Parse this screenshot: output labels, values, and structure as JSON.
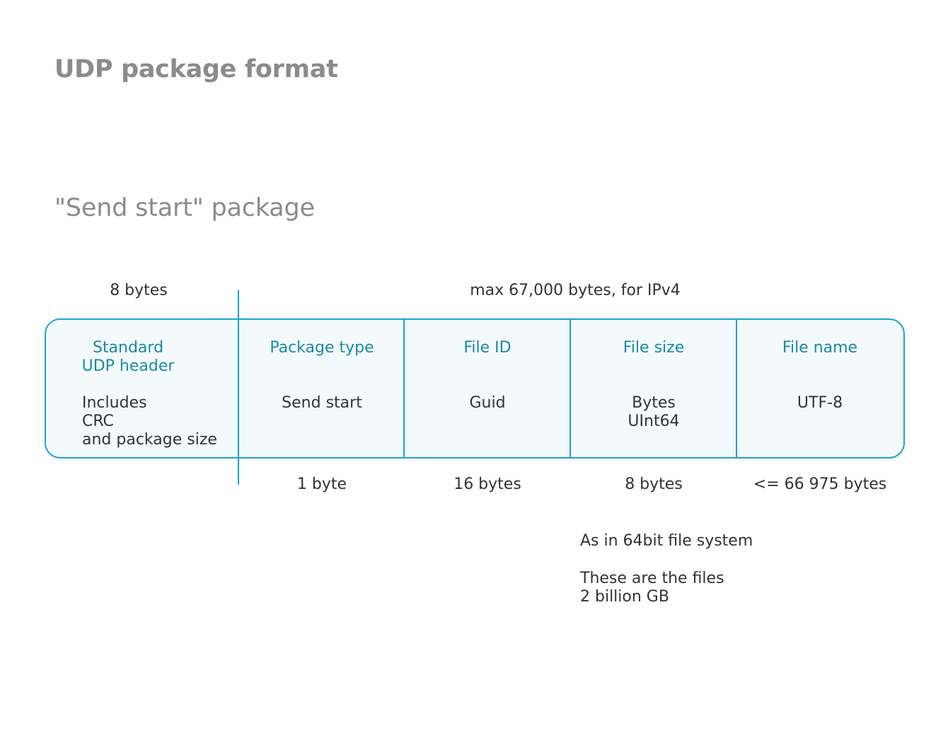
{
  "title": "UDP package format",
  "subtitle": "\"Send start\" package",
  "top_labels": {
    "header_size": "8 bytes",
    "payload_max": "max 67,000 bytes, for IPv4"
  },
  "fields": {
    "header": {
      "name_line1": "Standard",
      "name_line2": "UDP header",
      "value_line1": "Includes",
      "value_line2": "CRC",
      "value_line3": "and package size"
    },
    "package_type": {
      "name": "Package type",
      "value": "Send start",
      "size": "1 byte"
    },
    "file_id": {
      "name": "File ID",
      "value": "Guid",
      "size": "16 bytes"
    },
    "file_size": {
      "name": "File size",
      "value_line1": "Bytes",
      "value_line2": "UInt64",
      "size": "8 bytes"
    },
    "file_name": {
      "name": "File name",
      "value": "UTF-8",
      "size": "<= 66 975 bytes"
    }
  },
  "notes": {
    "line1": "As in 64bit file system",
    "line2": "These are the files",
    "line3": "2 billion GB"
  },
  "colors": {
    "accent": "#1aa3d1",
    "field_name": "#1a8aa6",
    "title": "#8b8b8b",
    "packet_fill": "#f4f9fc"
  }
}
